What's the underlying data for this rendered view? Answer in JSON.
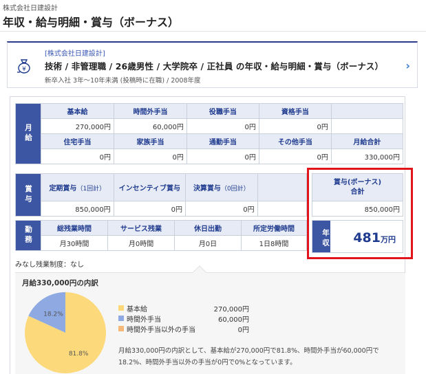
{
  "header": {
    "company": "株式会社日建設計",
    "title": "年収・給与明細・賞与（ボーナス）"
  },
  "card": {
    "company": "[株式会社日建設計]",
    "main": "技術 / 非管理職 / 26歳男性 / 大学院卒 / 正社員 の年収・給与明細・賞与（ボーナス）",
    "sub": "新卒入社 3年〜10年未満 (投稿時に在職) / 2008年度",
    "icon": "money-bag-icon",
    "chevron": "›"
  },
  "monthly": {
    "side": "月給",
    "row1_headers": [
      "基本給",
      "時間外手当",
      "役職手当",
      "資格手当",
      ""
    ],
    "row1_values": [
      "270,000円",
      "60,000円",
      "0円",
      "0円",
      ""
    ],
    "row2_headers": [
      "住宅手当",
      "家族手当",
      "通勤手当",
      "その他手当",
      "月給合計"
    ],
    "row2_values": [
      "0円",
      "0円",
      "0円",
      "0円",
      "330,000円"
    ]
  },
  "bonus": {
    "side": "賞与",
    "headers": [
      {
        "label": "定期賞与",
        "sub": "（1回計）"
      },
      {
        "label": "インセンティブ賞与",
        "sub": ""
      },
      {
        "label": "決算賞与",
        "sub": "（0回計）"
      },
      {
        "label": "",
        "sub": ""
      }
    ],
    "values": [
      "850,000円",
      "0円",
      "0円",
      ""
    ],
    "total_header_1": "賞与(ボーナス)",
    "total_header_2": "合計",
    "total_value": "850,000円"
  },
  "work": {
    "side": "勤務",
    "headers": [
      "総残業時間",
      "サービス残業",
      "休日出勤",
      "所定労働時間"
    ],
    "values": [
      "月30時間",
      "月0時間",
      "月0日",
      "1日8時間"
    ]
  },
  "annual": {
    "side": "年収",
    "value": "481",
    "unit": "万円"
  },
  "minashi": "みなし残業制度：なし",
  "breakdown": {
    "title": "月給330,000円の内訳",
    "note": "月給330,000円の内訳として、基本給が270,000円で81.8%、時間外手当が60,000円で18.2%、時間外手当以外の手当が0円で0%となっています。"
  },
  "chart_data": {
    "type": "pie",
    "categories": [
      "基本給",
      "時間外手当",
      "時間外手当以外の手当"
    ],
    "values": [
      270000,
      60000,
      0
    ],
    "amounts": [
      "270,000円",
      "60,000円",
      "0円"
    ],
    "percent_labels": [
      "81.8%",
      "18.2%",
      ""
    ],
    "colors": [
      "#fcd97a",
      "#8fa9e3",
      "#f7b97a"
    ]
  }
}
